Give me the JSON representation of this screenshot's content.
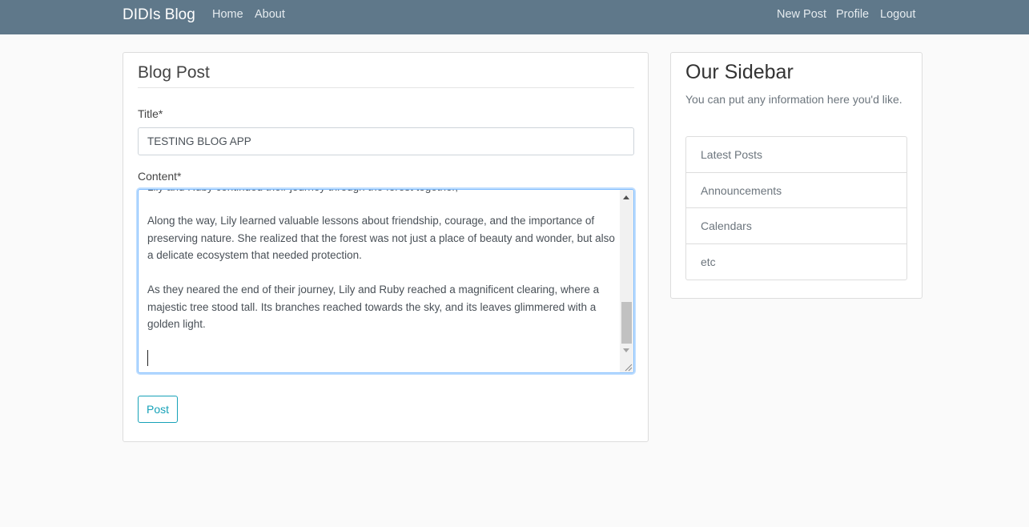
{
  "navbar": {
    "brand": "DIDIs Blog",
    "links_left": [
      "Home",
      "About"
    ],
    "links_right": [
      "New Post",
      "Profile",
      "Logout"
    ]
  },
  "form": {
    "legend": "Blog Post",
    "title_label": "Title*",
    "title_value": "TESTING BLOG APP",
    "content_label": "Content*",
    "content_cutoff_line": "Lily and Ruby continued their journey through the forest together, exploring its wonders.",
    "content_paragraphs": [
      "Along the way, Lily learned valuable lessons about friendship, courage, and the importance of preserving nature. She realized that the forest was not just a place of beauty and wonder, but also a delicate ecosystem that needed protection.",
      "As they neared the end of their journey, Lily and Ruby reached a magnificent clearing, where a majestic tree stood tall. Its branches reached towards the sky, and its leaves glimmered with a golden light."
    ],
    "submit_label": "Post"
  },
  "sidebar": {
    "title": "Our Sidebar",
    "description": "You can put any information here you'd like.",
    "items": [
      "Latest Posts",
      "Announcements",
      "Calendars",
      "etc"
    ]
  }
}
